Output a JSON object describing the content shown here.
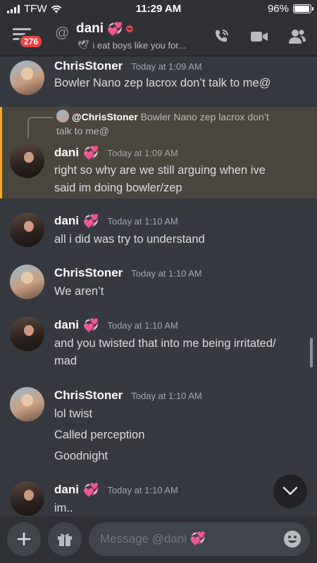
{
  "status_bar": {
    "carrier": "TFW",
    "time": "11:29 AM",
    "battery": "96%",
    "battery_level": 0.96
  },
  "header": {
    "unread_badge": "276",
    "name": "dani",
    "name_emoji": "💞",
    "status_text": "i eat boys like you for...",
    "status_emoji": "🕊",
    "icons": [
      "menu-icon",
      "at-icon",
      "call-icon",
      "video-icon",
      "members-icon"
    ]
  },
  "messages": [
    {
      "author": "ChrisStoner",
      "emoji": "",
      "time": "Today at 1:09 AM",
      "lines": [
        "Bowler Nano zep lacrox don’t talk to me@"
      ]
    },
    {
      "author": "dani",
      "emoji": "💞",
      "time": "Today at 1:09 AM",
      "reply": {
        "name": "@ChrisStoner",
        "text": "Bowler Nano zep lacrox don’t",
        "text2": "talk to me@"
      },
      "lines": [
        "right so why are we still arguing when ive",
        "said im doing bowler/zep"
      ]
    },
    {
      "author": "dani",
      "emoji": "💞",
      "time": "Today at 1:10 AM",
      "lines": [
        "all i did was try to understand"
      ]
    },
    {
      "author": "ChrisStoner",
      "emoji": "",
      "time": "Today at 1:10 AM",
      "lines": [
        "We aren’t"
      ]
    },
    {
      "author": "dani",
      "emoji": "💞",
      "time": "Today at 1:10 AM",
      "lines": [
        "and you twisted that into me being irritated/",
        "mad"
      ]
    },
    {
      "author": "ChrisStoner",
      "emoji": "",
      "time": "Today at 1:10 AM",
      "lines": [
        "lol twist",
        "Called perception",
        "Goodnight"
      ]
    },
    {
      "author": "dani",
      "emoji": "💞",
      "time": "Today at 1:10 AM",
      "lines": [
        "im.."
      ]
    }
  ],
  "composer": {
    "placeholder": "Message @dani",
    "placeholder_emoji": "💞"
  },
  "colors": {
    "background": "#36393f",
    "header": "#2f3136",
    "highlight": "#4a463d",
    "mention_bar": "#faa81a",
    "badge": "#ed4245"
  }
}
